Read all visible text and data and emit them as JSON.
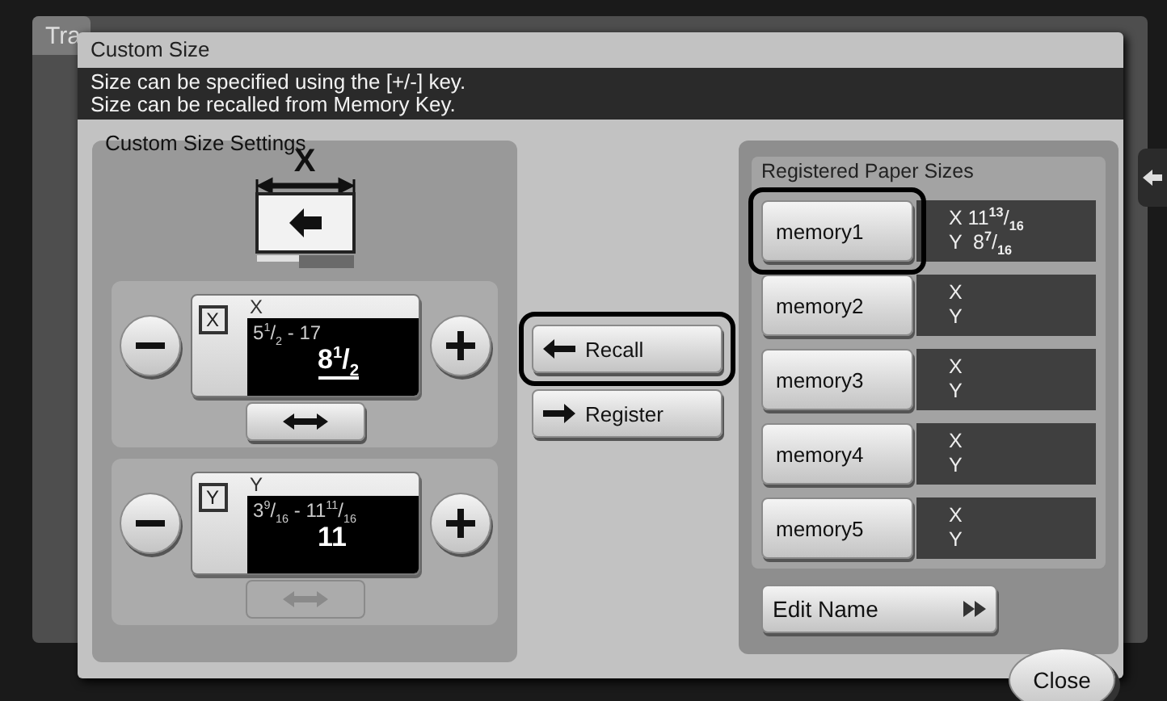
{
  "background": {
    "title": "Tra"
  },
  "dialog": {
    "title": "Custom Size",
    "messages": [
      "Size can be specified using the [+/-] key.",
      "Size can be recalled from Memory Key."
    ],
    "settings": {
      "title": "Custom Size Settings",
      "diagram_label": "X",
      "fields": [
        {
          "badge": "X",
          "label": "X",
          "range": "5$^{1}$/$_{2}$ - 17",
          "value": "8$^{1}$/$_{2}$",
          "active": true,
          "swap_disabled": false
        },
        {
          "badge": "Y",
          "label": "Y",
          "range": "3$^{9}$/$_{16}$ - 11$^{11}$/$_{16}$",
          "value": "11",
          "active": false,
          "swap_disabled": true
        }
      ]
    },
    "actions": [
      {
        "kind": "recall",
        "label": "Recall",
        "selected": true
      },
      {
        "kind": "register",
        "label": "Register",
        "selected": false
      }
    ],
    "registered": {
      "title": "Registered Paper Sizes",
      "memories": [
        {
          "name": "memory1",
          "selected": true,
          "x": "X 11$^{13}$/$_{16}$",
          "y": "Y  8$^{7}$/$_{16}$"
        },
        {
          "name": "memory2",
          "selected": false,
          "x": "X",
          "y": "Y"
        },
        {
          "name": "memory3",
          "selected": false,
          "x": "X",
          "y": "Y"
        },
        {
          "name": "memory4",
          "selected": false,
          "x": "X",
          "y": "Y"
        },
        {
          "name": "memory5",
          "selected": false,
          "x": "X",
          "y": "Y"
        }
      ]
    },
    "edit_name": "Edit Name",
    "close": "Close"
  }
}
